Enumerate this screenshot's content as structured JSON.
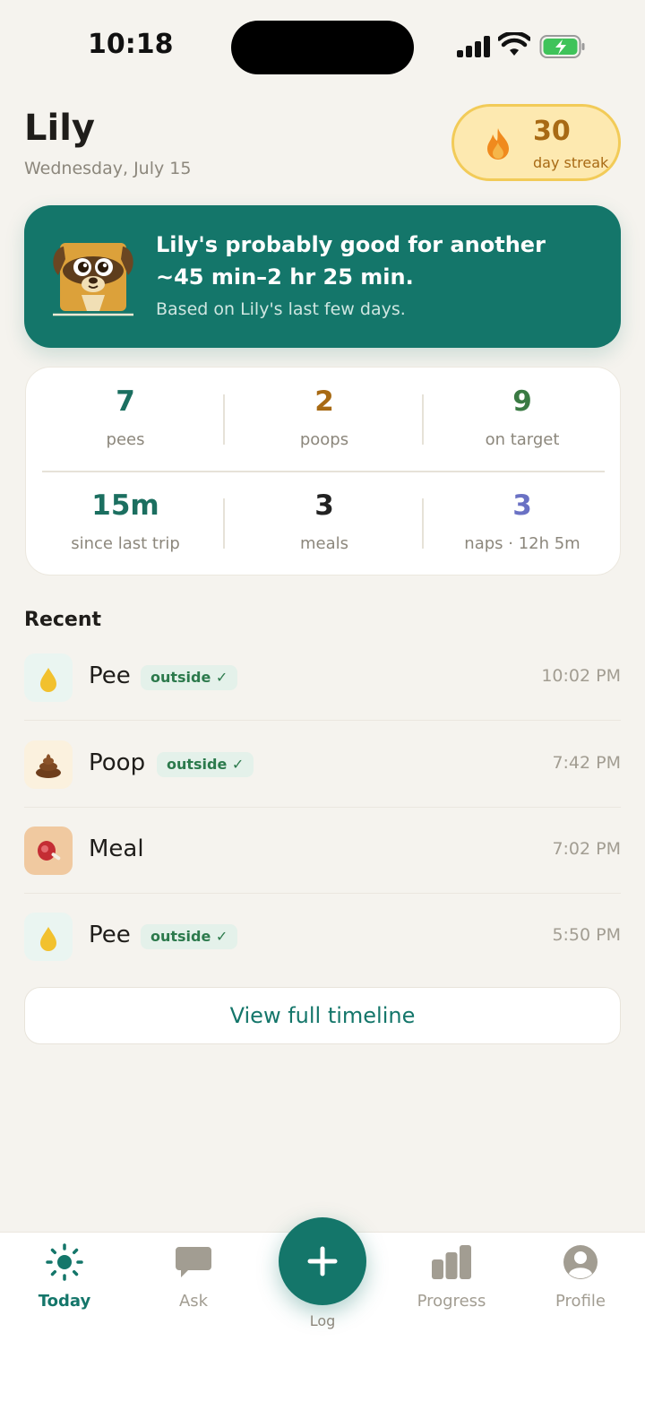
{
  "status_bar": {
    "time": "10:18"
  },
  "header": {
    "dog_name": "Lily",
    "date": "Wednesday, July 15",
    "streak": {
      "value": "30",
      "label": "day streak"
    }
  },
  "prediction": {
    "title": "Lily's probably good for another ~45 min–2 hr 25 min.",
    "subtitle": "Based on Lily's last few days."
  },
  "stats": [
    {
      "value": "7",
      "label": "pees",
      "color": "#1b6f60"
    },
    {
      "value": "2",
      "label": "poops",
      "color": "#a86a14"
    },
    {
      "value": "9",
      "label": "on target",
      "color": "#3a7a43"
    },
    {
      "value": "15m",
      "label": "since last trip",
      "color": "#1b6f60"
    },
    {
      "value": "3",
      "label": "meals",
      "color": "#222222"
    },
    {
      "value": "3",
      "label": "naps · 12h 5m",
      "color": "#6a71c4"
    }
  ],
  "recent": {
    "title": "Recent",
    "items": [
      {
        "label": "Pee",
        "badge": "outside ✓",
        "time": "10:02 PM",
        "icon": "pee-drop-icon"
      },
      {
        "label": "Poop",
        "badge": "outside ✓",
        "time": "7:42 PM",
        "icon": "poop-icon"
      },
      {
        "label": "Meal",
        "badge": "",
        "time": "7:02 PM",
        "icon": "meat-icon"
      },
      {
        "label": "Pee",
        "badge": "outside ✓",
        "time": "5:50 PM",
        "icon": "pee-drop-icon"
      }
    ],
    "view_all": "View full timeline"
  },
  "tabbar": {
    "tabs": [
      {
        "label": "Today",
        "icon": "sun-icon",
        "active": true
      },
      {
        "label": "Ask",
        "icon": "chat-bubble-icon",
        "active": false
      },
      {
        "label": "Progress",
        "icon": "bar-chart-icon",
        "active": false
      },
      {
        "label": "Profile",
        "icon": "person-icon",
        "active": false
      }
    ],
    "log_label": "Log"
  },
  "colors": {
    "primary": "#14766a",
    "background": "#f5f3ee",
    "streak_bg": "#fde9b0"
  }
}
